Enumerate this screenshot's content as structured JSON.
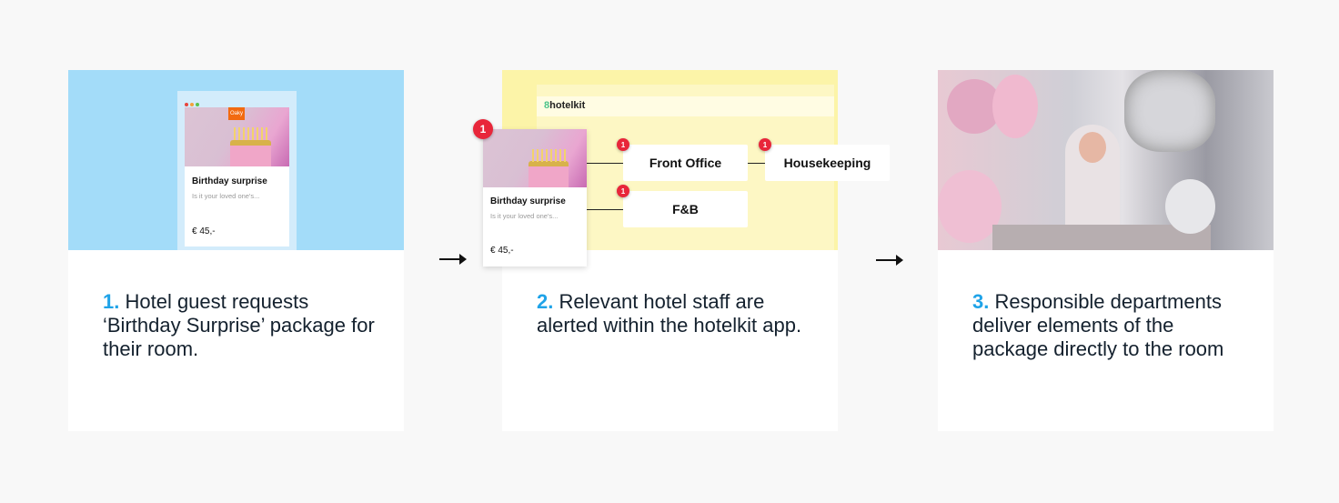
{
  "colors": {
    "accent": "#1fa3e8",
    "step1_bg": "#a3dcf9",
    "step2_bg": "#fcf4a8",
    "badge": "#e8263a"
  },
  "product": {
    "logo": "Oaky",
    "title": "Birthday surprise",
    "description": "Is it your loved one's...",
    "price": "€ 45,-"
  },
  "app": {
    "brand": "hotelkit"
  },
  "departments": [
    {
      "name": "Front Office",
      "badge": "1"
    },
    {
      "name": "Housekeeping",
      "badge": "1"
    },
    {
      "name": "F&B",
      "badge": "1"
    }
  ],
  "card_badge": "1",
  "steps": [
    {
      "number": "1.",
      "text": " Hotel guest requests ‘Birthday Surprise’ package for their room."
    },
    {
      "number": "2.",
      "text": " Relevant hotel staff are alerted within the hotelkit app."
    },
    {
      "number": "3.",
      "text": " Responsible departments deliver elements of the package directly to the room"
    }
  ]
}
